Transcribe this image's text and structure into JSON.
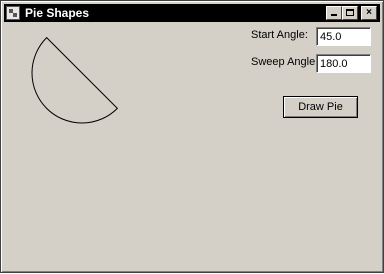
{
  "window": {
    "title": "Pie Shapes",
    "controls": {
      "close": "×"
    }
  },
  "form": {
    "start_angle_label": "Start Angle:",
    "start_angle_value": "45.0",
    "sweep_angle_label": "Sweep Angle:",
    "sweep_angle_value": "180.0",
    "draw_button_label": "Draw Pie"
  },
  "pie": {
    "start_angle": 45.0,
    "sweep_angle": 180.0,
    "stroke_color": "#000000"
  }
}
